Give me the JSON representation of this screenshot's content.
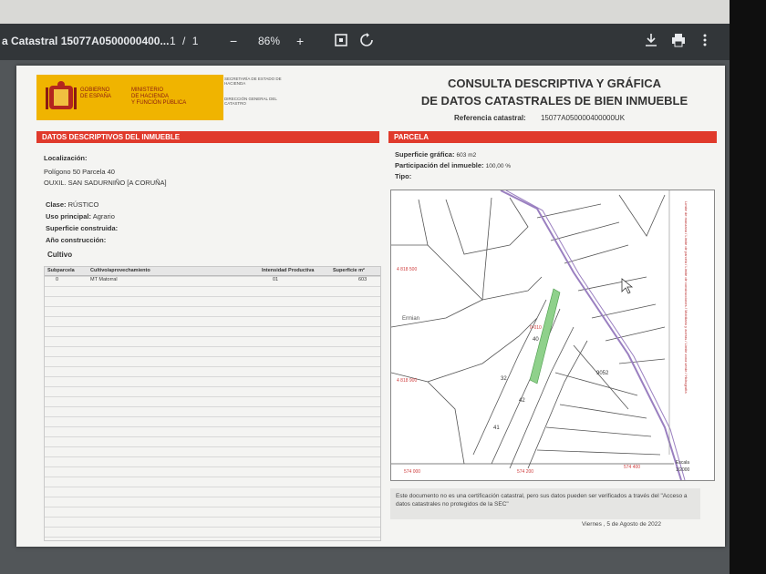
{
  "toolbar": {
    "title": "a Catastral 15077A0500000400...",
    "page_current": "1",
    "page_sep": "/",
    "page_total": "1",
    "zoom_out": "−",
    "zoom": "86%",
    "zoom_in": "+"
  },
  "header": {
    "logo_line1": "GOBIERNO\nDE ESPAÑA",
    "logo_line2": "MINISTERIO\nDE HACIENDA\nY FUNCIÓN PÚBLICA",
    "secretaria": "SECRETARÍA DE ESTADO DE HACIENDA",
    "direccion": "DIRECCIÓN GENERAL DEL CATASTRO",
    "title_line1": "CONSULTA DESCRIPTIVA Y GRÁFICA",
    "title_line2": "DE DATOS CATASTRALES DE BIEN INMUEBLE",
    "ref_label": "Referencia catastral:",
    "ref_value": "15077A050000400000UK"
  },
  "left": {
    "section_title": "DATOS DESCRIPTIVOS DEL INMUEBLE",
    "localizacion_label": "Localización:",
    "localizacion_line1": "Polígono 50 Parcela 40",
    "localizacion_line2": "OUXIL. SAN SADURNIÑO [A CORUÑA]",
    "clase_label": "Clase:",
    "clase_value": "RÚSTICO",
    "uso_label": "Uso principal:",
    "uso_value": "Agrario",
    "superficie_label": "Superficie construida:",
    "anio_label": "Año construcción:",
    "cultivo_label": "Cultivo",
    "columns": [
      "Subparcela",
      "Cultivo/aprovechamiento",
      "Intensidad Productiva",
      "Superficie m²"
    ],
    "rows": [
      [
        "0",
        "MT Matorral",
        "01",
        "603"
      ]
    ]
  },
  "right": {
    "section_title": "PARCELA",
    "sup_label": "Superficie gráfica:",
    "sup_value": "603 m2",
    "part_label": "Participación del inmueble:",
    "part_value": "100,00 %",
    "tipo_label": "Tipo:"
  },
  "map": {
    "labels": [
      "Ermian",
      "9052",
      "40",
      "41",
      "42",
      "32",
      "0-010",
      "4 818 500",
      "4 818 900",
      "574 000",
      "574 200",
      "574 400"
    ],
    "scale_label": "Escala",
    "scale_value": "1/2000",
    "legend_text": "Límite de manzana / Límite de parcela / Límite de construcciones / Mobiliario y aceras / Límite zona verde / Hidrografía"
  },
  "footer": {
    "note": "Este documento no es una certificación catastral, pero sus datos pueden ser verificados a través del \"Acceso a datos catastrales no protegidos de la SEC\"",
    "date": "Viernes , 5 de Agosto de 2022"
  },
  "colors": {
    "section_red": "#e03a2c",
    "logo_yellow": "#f0b400",
    "parcel_green": "#8fd18b",
    "road_purple": "#9a7fc0"
  }
}
